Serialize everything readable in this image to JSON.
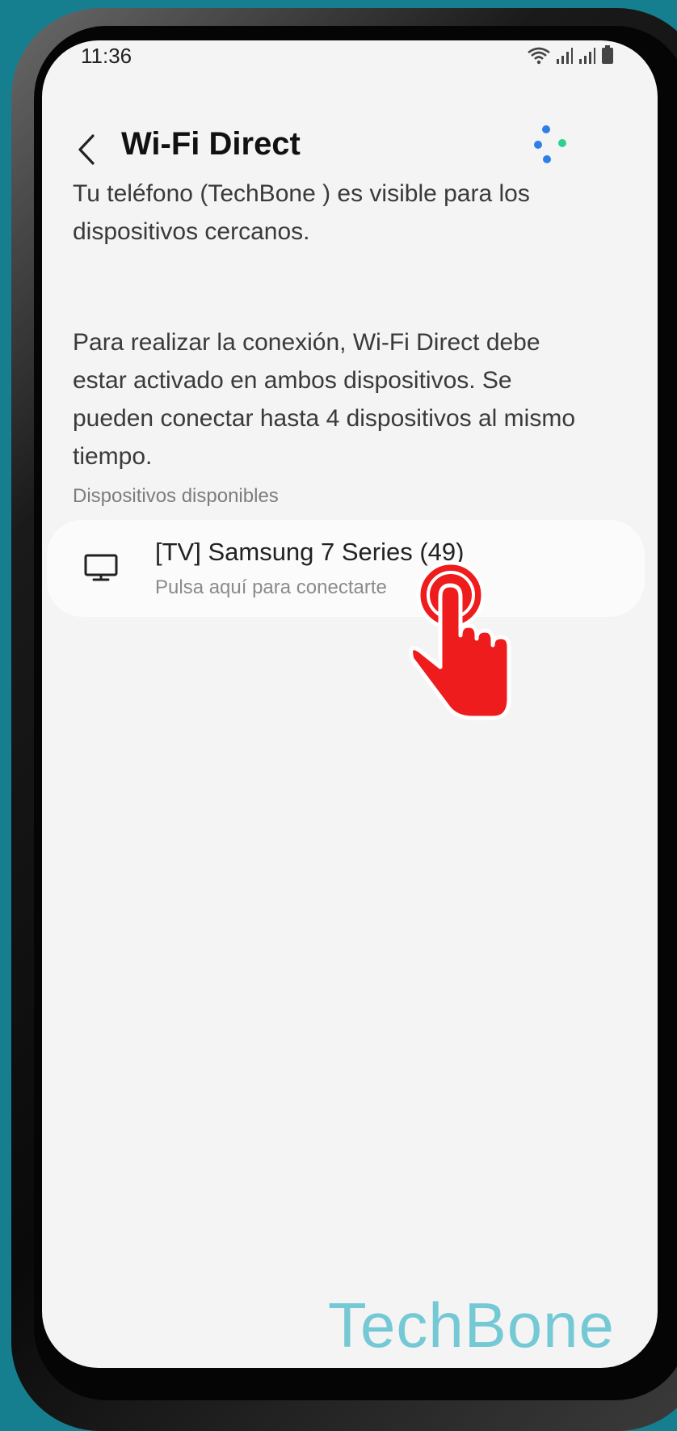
{
  "status_bar": {
    "time": "11:36"
  },
  "header": {
    "title": "Wi-Fi Direct"
  },
  "body": {
    "visibility_text": "Tu teléfono (TechBone ) es visible para los dispositivos cercanos.",
    "instructions_text": "Para realizar la conexión, Wi-Fi Direct debe estar activado en ambos dispositivos. Se pueden conectar hasta 4 dispositivos al mismo tiempo."
  },
  "available_devices": {
    "section_label": "Dispositivos disponibles",
    "items": [
      {
        "name": "[TV] Samsung 7 Series (49)",
        "subtitle": "Pulsa aquí para conectarte",
        "icon": "tv-icon"
      }
    ]
  },
  "watermark": {
    "text": "TechBone"
  },
  "colors": {
    "background": "#167f8f",
    "screen": "#f4f4f4",
    "card": "#fbfbfb",
    "pointer": "#ee1c1c",
    "watermark": "#5ec2d0",
    "dot_blue": "#2f7fe9",
    "dot_green": "#2fcf8f"
  }
}
